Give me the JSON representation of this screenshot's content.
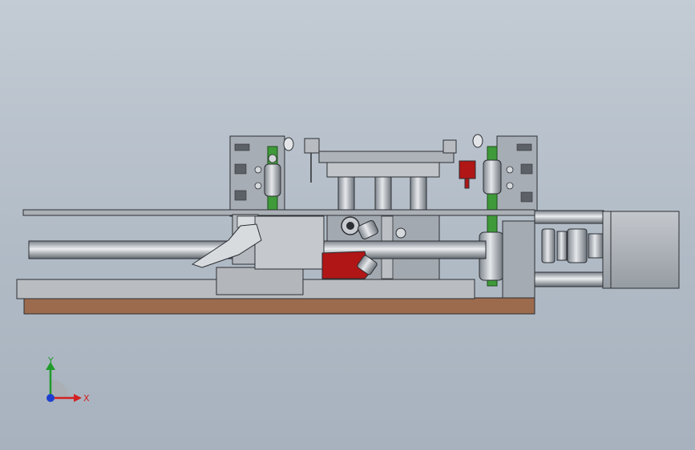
{
  "viewport": {
    "background_top": "#c3cbd4",
    "background_bottom": "#a7b2be"
  },
  "triad": {
    "x_label": "X",
    "y_label": "Y",
    "x_color": "#d42020",
    "y_color": "#1f9a2a",
    "z_color": "#1d3fd0"
  },
  "model": {
    "parts": [
      "base-plate",
      "baseboard",
      "left-bracket",
      "right-bracket",
      "left-pulley",
      "right-pulley",
      "green-belt-left",
      "green-belt-right",
      "guide-rail",
      "long-shaft",
      "slider-block",
      "clamp-arm",
      "red-part",
      "red-sensor",
      "top-frame",
      "support-column",
      "stepper-motor",
      "coupling"
    ],
    "colors": {
      "metal": "#9ea4ab",
      "metal_light": "#c8ccd1",
      "dark_edge": "#2c2f33",
      "belt_green": "#3f9a3a",
      "red_part": "#b01616",
      "wood": "#9c6b4d"
    }
  }
}
